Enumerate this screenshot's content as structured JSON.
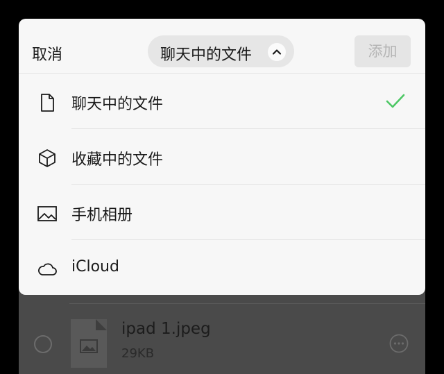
{
  "header": {
    "cancel_label": "取消",
    "source_title": "聊天中的文件",
    "add_label": "添加"
  },
  "menu": {
    "items": [
      {
        "label": "聊天中的文件",
        "icon": "document-icon",
        "selected": true
      },
      {
        "label": "收藏中的文件",
        "icon": "cube-icon",
        "selected": false
      },
      {
        "label": "手机相册",
        "icon": "photo-icon",
        "selected": false
      },
      {
        "label": "iCloud",
        "icon": "cloud-icon",
        "selected": false
      }
    ]
  },
  "background_list": {
    "files": [
      {
        "name": "ipad 1.jpeg",
        "size": "29KB"
      }
    ]
  },
  "colors": {
    "check": "#4cc764",
    "sheet_bg": "#f7f7f7",
    "dim_bg": "#4a4a4a",
    "add_text_disabled": "#b5b5b5"
  }
}
